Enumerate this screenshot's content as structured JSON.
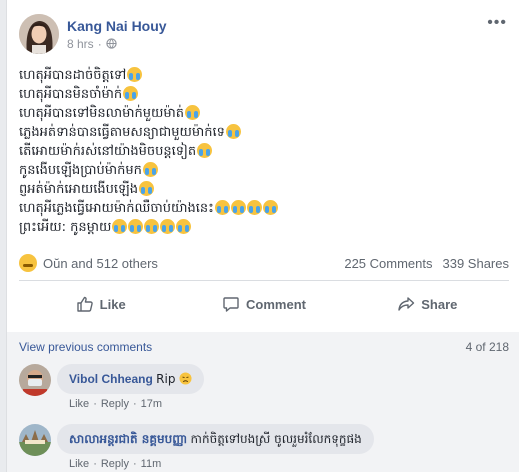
{
  "post": {
    "author": "Kang Nai Houy",
    "time": "8 hrs",
    "privacy_icon": "globe-icon",
    "more_icon": "ellipsis-icon",
    "lines": [
      "ហេតុអីបានដាច់ចិត្តទៅ",
      "ហេតុអីបានមិនចាំម៉ាក់",
      "ហេតុអីបានទៅមិនលាម៉ាក់មួយម៉ាត់",
      "ភ្លេងអត់ទាន់បានធ្វើតាមសន្យាជាមួយម៉ាក់ទេ",
      "តើអោយម៉ាក់រស់នៅយ៉ាងមិចបន្តទៀត",
      "កូនងើបឡើងប្រាប់ម៉ាក់មក",
      "ព្ញអត់ម៉ាក់អោយងើបឡើង",
      "ហេតុអីភ្លេងធ្វើអោយម៉ាក់ឈឺចាប់យ៉ាងនេះ",
      "ព្រះអើយ: កូនម្តាយ"
    ],
    "line_emoji_counts": [
      1,
      1,
      1,
      1,
      1,
      1,
      1,
      4,
      5
    ],
    "emoji_icon": "crying-face-icon"
  },
  "reactions": {
    "icon": "sad-reaction-icon",
    "text": "Oŭn and 512 others",
    "comments": "225 Comments",
    "shares": "339 Shares"
  },
  "actions": {
    "like": "Like",
    "comment": "Comment",
    "share": "Share"
  },
  "comments_section": {
    "view_previous": "View previous comments",
    "count": "4 of 218",
    "items": [
      {
        "name": "Vibol Chheang",
        "text": "Rip",
        "emoji": "disappointed-face-icon",
        "like": "Like",
        "reply": "Reply",
        "time": "17m"
      },
      {
        "name": "សាលាអន្តរជាតិ នគ្គមបញ្ញា",
        "text": "កាក់ចិត្តទៅបងស្រី ចូលរួមរំលែកទុក្ខផង",
        "like": "Like",
        "reply": "Reply",
        "time": "11m"
      }
    ]
  },
  "colors": {
    "link": "#385898",
    "muted": "#606770",
    "divider": "#dadde1"
  }
}
